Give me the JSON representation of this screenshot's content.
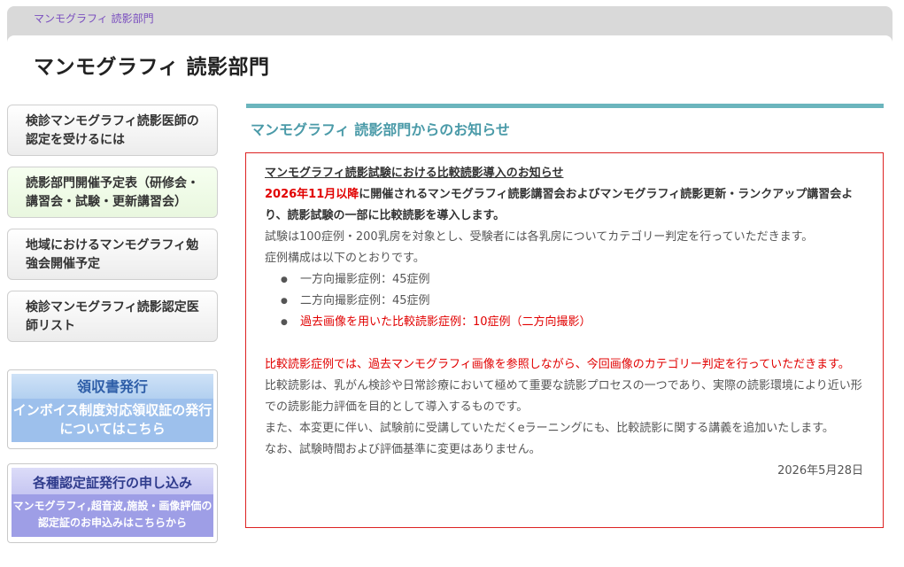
{
  "breadcrumb": "マンモグラフィ 読影部門",
  "site_title": "マンモグラフィ 読影部門",
  "sidebar": {
    "items": [
      {
        "label": "検診マンモグラフィ読影医師の認定を受けるには"
      },
      {
        "label": "読影部門開催予定表（研修会・講習会・試験・更新講習会）"
      },
      {
        "label": "地域におけるマンモグラフィ勉強会開催予定"
      },
      {
        "label": "検診マンモグラフィ読影認定医師リスト"
      }
    ],
    "banners": [
      {
        "title": "領収書発行",
        "body": "インボイス制度対応領収証の発行についてはこちら"
      },
      {
        "title": "各種認定証発行の申し込み",
        "body": "マンモグラフィ,超音波,施設・画像評価の認定証のお申込みはこちらから"
      }
    ]
  },
  "main": {
    "heading": "マンモグラフィ 読影部門からのお知らせ",
    "notice": {
      "title": "マンモグラフィ読影試験における比較読影導入のお知らせ",
      "lead_red": "2026年11月以降",
      "lead_rest": "に開催されるマンモグラフィ読影講習会およびマンモグラフィ読影更新・ランクアップ講習会より、読影試験の一部に比較読影を導入します。",
      "para1": "試験は100症例・200乳房を対象とし、受験者には各乳房についてカテゴリー判定を行っていただきます。",
      "para2": "症例構成は以下のとおりです。",
      "items": [
        "一方向撮影症例：45症例",
        "二方向撮影症例：45症例",
        "過去画像を用いた比較読影症例：10症例（二方向撮影）"
      ],
      "red_para": "比較読影症例では、過去マンモグラフィ画像を参照しながら、今回画像のカテゴリー判定を行っていただきます。",
      "para3": "比較読影は、乳がん検診や日常診療において極めて重要な読影プロセスの一つであり、実際の読影環境により近い形での読影能力評価を目的として導入するものです。",
      "para4": "また、本変更に伴い、試験前に受講していただくeラーニングにも、比較読影に関する講義を追加いたします。",
      "para5": "なお、試験時間および評価基準に変更はありません。",
      "date": "2026年5月28日"
    }
  },
  "colors": {
    "accent_teal": "#4a9aa8",
    "notice_border": "#dd2222",
    "highlight_red": "#e10000",
    "breadcrumb_purple": "#7a4fbf"
  }
}
